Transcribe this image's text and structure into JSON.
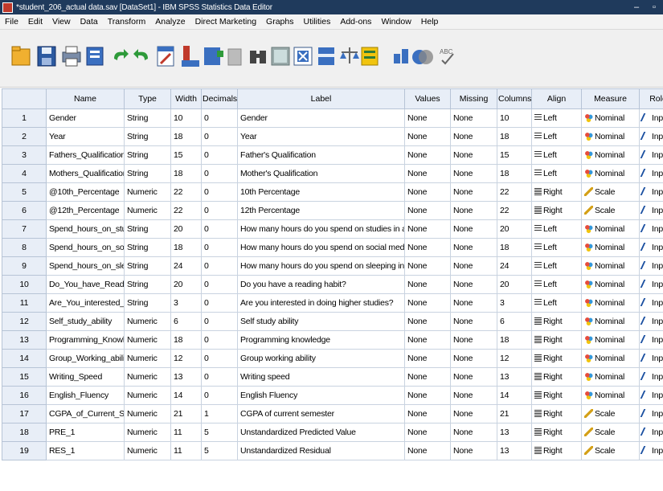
{
  "window": {
    "title": "*student_206_actual data.sav [DataSet1] - IBM SPSS Statistics Data Editor"
  },
  "menu": [
    "File",
    "Edit",
    "View",
    "Data",
    "Transform",
    "Analyze",
    "Direct Marketing",
    "Graphs",
    "Utilities",
    "Add-ons",
    "Window",
    "Help"
  ],
  "toolbar_icons": [
    "open-icon",
    "save-icon",
    "print-icon",
    "dialog-recall-icon",
    "undo-icon",
    "redo-icon",
    "goto-case-icon",
    "goto-variable-icon",
    "variables-icon",
    "run-descriptives-icon",
    "find-icon",
    "insert-cases-icon",
    "insert-variable-icon",
    "split-file-icon",
    "weight-cases-icon",
    "select-cases-icon",
    "value-labels-icon",
    "use-variable-sets-icon",
    "spell-check-icon"
  ],
  "columns": [
    "Name",
    "Type",
    "Width",
    "Decimals",
    "Label",
    "Values",
    "Missing",
    "Columns",
    "Align",
    "Measure",
    "Role"
  ],
  "rows": [
    {
      "n": "1",
      "name": "Gender",
      "type": "String",
      "width": "10",
      "dec": "0",
      "label": "Gender",
      "values": "None",
      "missing": "None",
      "cols": "10",
      "align": "Left",
      "measure": "Nominal",
      "role": "Input"
    },
    {
      "n": "2",
      "name": "Year",
      "type": "String",
      "width": "18",
      "dec": "0",
      "label": "Year",
      "values": "None",
      "missing": "None",
      "cols": "18",
      "align": "Left",
      "measure": "Nominal",
      "role": "Input"
    },
    {
      "n": "3",
      "name": "Fathers_Qualification",
      "type": "String",
      "width": "15",
      "dec": "0",
      "label": "Father's Qualification",
      "values": "None",
      "missing": "None",
      "cols": "15",
      "align": "Left",
      "measure": "Nominal",
      "role": "Input"
    },
    {
      "n": "4",
      "name": "Mothers_Qualification",
      "type": "String",
      "width": "18",
      "dec": "0",
      "label": "Mother's Qualification",
      "values": "None",
      "missing": "None",
      "cols": "18",
      "align": "Left",
      "measure": "Nominal",
      "role": "Input"
    },
    {
      "n": "5",
      "name": "@10th_Percentage",
      "type": "Numeric",
      "width": "22",
      "dec": "0",
      "label": "10th Percentage",
      "values": "None",
      "missing": "None",
      "cols": "22",
      "align": "Right",
      "measure": "Scale",
      "role": "Input"
    },
    {
      "n": "6",
      "name": "@12th_Percentage",
      "type": "Numeric",
      "width": "22",
      "dec": "0",
      "label": "12th Percentage",
      "values": "None",
      "missing": "None",
      "cols": "22",
      "align": "Right",
      "measure": "Scale",
      "role": "Input"
    },
    {
      "n": "7",
      "name": "Spend_hours_on_studi...",
      "type": "String",
      "width": "20",
      "dec": "0",
      "label": "How many hours do you spend on studies in a day?",
      "values": "None",
      "missing": "None",
      "cols": "20",
      "align": "Left",
      "measure": "Nominal",
      "role": "Input"
    },
    {
      "n": "8",
      "name": "Spend_hours_on_soci...",
      "type": "String",
      "width": "18",
      "dec": "0",
      "label": "How many hours do you spend on social media in a day?",
      "values": "None",
      "missing": "None",
      "cols": "18",
      "align": "Left",
      "measure": "Nominal",
      "role": "Input"
    },
    {
      "n": "9",
      "name": "Spend_hours_on_slee...",
      "type": "String",
      "width": "24",
      "dec": "0",
      "label": "How many hours do you spend on sleeping in a day?",
      "values": "None",
      "missing": "None",
      "cols": "24",
      "align": "Left",
      "measure": "Nominal",
      "role": "Input"
    },
    {
      "n": "10",
      "name": "Do_You_have_Reading...",
      "type": "String",
      "width": "20",
      "dec": "0",
      "label": "Do you have a reading habit?",
      "values": "None",
      "missing": "None",
      "cols": "20",
      "align": "Left",
      "measure": "Nominal",
      "role": "Input"
    },
    {
      "n": "11",
      "name": "Are_You_interested_in...",
      "type": "String",
      "width": "3",
      "dec": "0",
      "label": "Are you interested in doing higher studies?",
      "values": "None",
      "missing": "None",
      "cols": "3",
      "align": "Left",
      "measure": "Nominal",
      "role": "Input"
    },
    {
      "n": "12",
      "name": "Self_study_ability",
      "type": "Numeric",
      "width": "6",
      "dec": "0",
      "label": "Self study ability",
      "values": "None",
      "missing": "None",
      "cols": "6",
      "align": "Right",
      "measure": "Nominal",
      "role": "Input"
    },
    {
      "n": "13",
      "name": "Programming_Knowled...",
      "type": "Numeric",
      "width": "18",
      "dec": "0",
      "label": "Programming knowledge",
      "values": "None",
      "missing": "None",
      "cols": "18",
      "align": "Right",
      "measure": "Nominal",
      "role": "Input"
    },
    {
      "n": "14",
      "name": "Group_Working_ability",
      "type": "Numeric",
      "width": "12",
      "dec": "0",
      "label": "Group working ability",
      "values": "None",
      "missing": "None",
      "cols": "12",
      "align": "Right",
      "measure": "Nominal",
      "role": "Input"
    },
    {
      "n": "15",
      "name": "Writing_Speed",
      "type": "Numeric",
      "width": "13",
      "dec": "0",
      "label": "Writing speed",
      "values": "None",
      "missing": "None",
      "cols": "13",
      "align": "Right",
      "measure": "Nominal",
      "role": "Input"
    },
    {
      "n": "16",
      "name": "English_Fluency",
      "type": "Numeric",
      "width": "14",
      "dec": "0",
      "label": "English Fluency",
      "values": "None",
      "missing": "None",
      "cols": "14",
      "align": "Right",
      "measure": "Nominal",
      "role": "Input"
    },
    {
      "n": "17",
      "name": "CGPA_of_Current_Se...",
      "type": "Numeric",
      "width": "21",
      "dec": "1",
      "label": "CGPA of current semester",
      "values": "None",
      "missing": "None",
      "cols": "21",
      "align": "Right",
      "measure": "Scale",
      "role": "Input"
    },
    {
      "n": "18",
      "name": "PRE_1",
      "type": "Numeric",
      "width": "11",
      "dec": "5",
      "label": "Unstandardized Predicted Value",
      "values": "None",
      "missing": "None",
      "cols": "13",
      "align": "Right",
      "measure": "Scale",
      "role": "Input"
    },
    {
      "n": "19",
      "name": "RES_1",
      "type": "Numeric",
      "width": "11",
      "dec": "5",
      "label": "Unstandardized Residual",
      "values": "None",
      "missing": "None",
      "cols": "13",
      "align": "Right",
      "measure": "Scale",
      "role": "Input"
    }
  ]
}
